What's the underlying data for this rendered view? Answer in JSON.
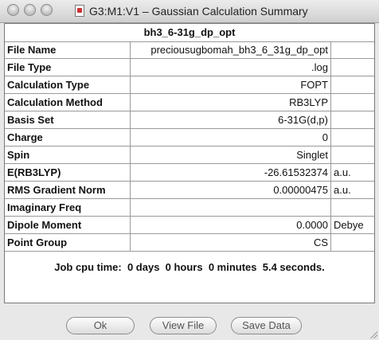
{
  "window": {
    "title": "G3:M1:V1 – Gaussian Calculation Summary"
  },
  "summary": {
    "header": "bh3_6-31g_dp_opt",
    "rows": [
      {
        "label": "File Name",
        "value": "preciousugbomah_bh3_6_31g_dp_opt",
        "unit": ""
      },
      {
        "label": "File Type",
        "value": ".log",
        "unit": ""
      },
      {
        "label": "Calculation Type",
        "value": "FOPT",
        "unit": ""
      },
      {
        "label": "Calculation Method",
        "value": "RB3LYP",
        "unit": ""
      },
      {
        "label": "Basis Set",
        "value": "6-31G(d,p)",
        "unit": ""
      },
      {
        "label": "Charge",
        "value": "0",
        "unit": ""
      },
      {
        "label": "Spin",
        "value": "Singlet",
        "unit": ""
      },
      {
        "label": "E(RB3LYP)",
        "value": "-26.61532374",
        "unit": "a.u."
      },
      {
        "label": "RMS Gradient Norm",
        "value": "0.00000475",
        "unit": "a.u."
      },
      {
        "label": "Imaginary Freq",
        "value": "",
        "unit": ""
      },
      {
        "label": "Dipole Moment",
        "value": "0.0000",
        "unit": "Debye"
      },
      {
        "label": "Point Group",
        "value": "CS",
        "unit": ""
      }
    ],
    "job_time": "Job cpu time:  0 days  0 hours  0 minutes  5.4 seconds."
  },
  "buttons": {
    "ok": "Ok",
    "view_file": "View File",
    "save_data": "Save Data"
  }
}
